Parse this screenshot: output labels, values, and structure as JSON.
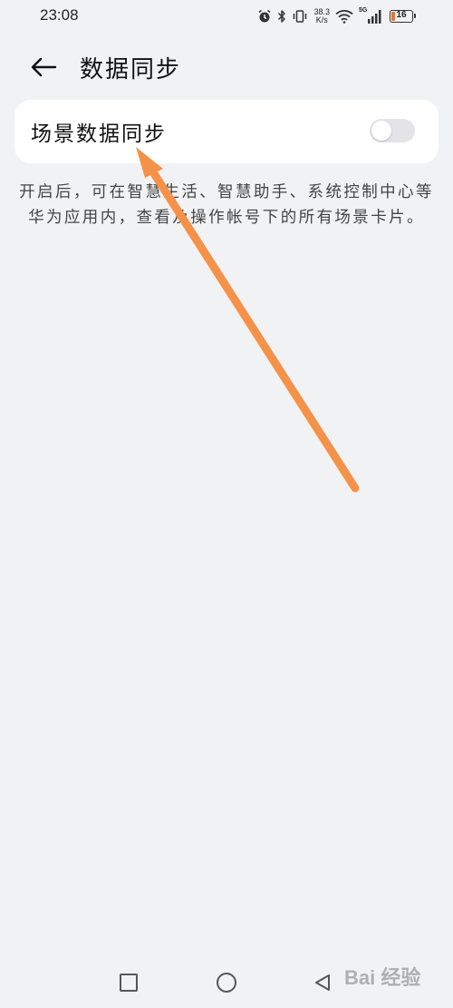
{
  "status_bar": {
    "time": "23:08",
    "net_speed_value": "38.3",
    "net_speed_unit": "K/s",
    "signal_label": "5G",
    "battery_level": "16",
    "icons": [
      "alarm-icon",
      "bluetooth-icon",
      "vibrate-icon",
      "wifi-icon",
      "signal-icon",
      "battery-icon"
    ]
  },
  "header": {
    "back_icon": "arrow-left-icon",
    "title": "数据同步"
  },
  "setting": {
    "label": "场景数据同步",
    "toggle_on": false
  },
  "description": "开启后，可在智慧生活、智慧助手、系统控制中心等华为应用内，查看及操作帐号下的所有场景卡片。",
  "annotation": {
    "arrow_color": "#f5924a"
  },
  "nav_bar": {
    "icons": [
      "recents-square-icon",
      "home-circle-icon",
      "back-triangle-icon"
    ]
  },
  "watermark": {
    "text": "Bai 经验"
  }
}
